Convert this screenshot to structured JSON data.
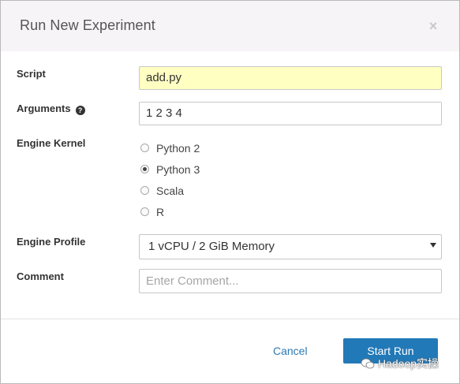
{
  "dialog": {
    "title": "Run New Experiment",
    "close_glyph": "×"
  },
  "form": {
    "script": {
      "label": "Script",
      "value": "add.py"
    },
    "arguments": {
      "label": "Arguments",
      "value": "1 2 3 4",
      "help_glyph": "?"
    },
    "engine_kernel": {
      "label": "Engine Kernel",
      "options": [
        "Python 2",
        "Python 3",
        "Scala",
        "R"
      ],
      "selected": "Python 3"
    },
    "engine_profile": {
      "label": "Engine Profile",
      "value": "1 vCPU / 2 GiB Memory"
    },
    "comment": {
      "label": "Comment",
      "value": "",
      "placeholder": "Enter Comment..."
    }
  },
  "footer": {
    "cancel_label": "Cancel",
    "start_label": "Start Run"
  },
  "watermark": {
    "text": "Hadoop实操",
    "icon": "wechat-icon"
  },
  "colors": {
    "header_bg": "#f6f4f7",
    "script_highlight": "#ffffc2",
    "primary": "#2279b8",
    "link": "#2c7ab5"
  }
}
